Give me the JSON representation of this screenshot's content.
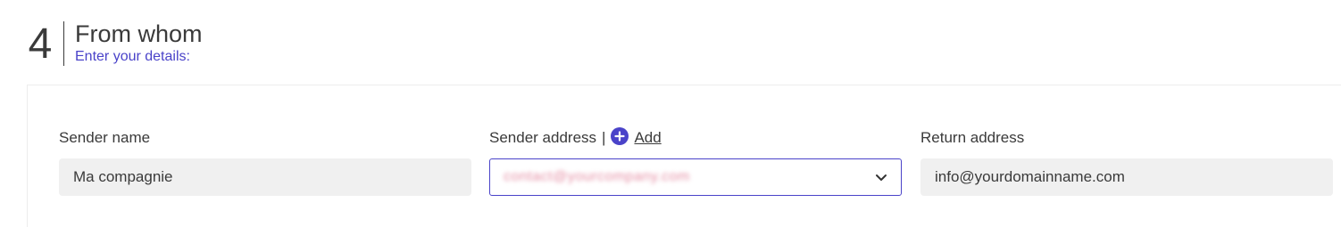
{
  "step": {
    "number": "4",
    "title": "From whom",
    "subtitle": "Enter your details:"
  },
  "fields": {
    "sender_name": {
      "label": "Sender name",
      "value": "Ma compagnie"
    },
    "sender_address": {
      "label": "Sender address",
      "separator": "|",
      "add_label": "Add",
      "selected_value_blurred": "contact@yourcompany.com"
    },
    "return_address": {
      "label": "Return address",
      "value": "info@yourdomainname.com"
    }
  },
  "colors": {
    "accent": "#4a43c9",
    "text": "#3a3a3a",
    "input_bg": "#f0f0f0",
    "blurred_value": "#e58ea4"
  },
  "icons": {
    "add": "plus-circle-icon",
    "dropdown": "chevron-down-icon"
  }
}
